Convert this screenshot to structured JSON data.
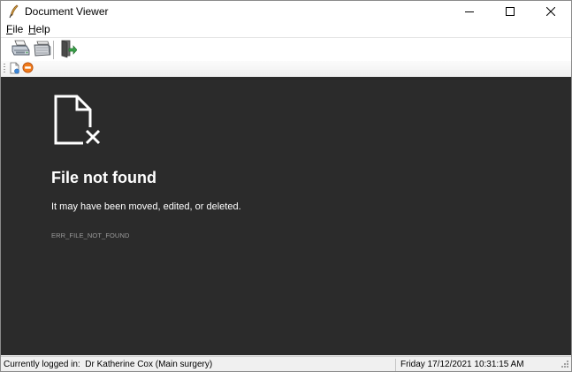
{
  "window": {
    "title": "Document Viewer"
  },
  "menu": {
    "file": {
      "mnemonic": "F",
      "rest": "ile"
    },
    "help": {
      "mnemonic": "H",
      "rest": "elp"
    }
  },
  "toolbar": {
    "icons": [
      "printer-icon",
      "scanner-icon",
      "exit-door-icon"
    ]
  },
  "small_toolbar": {
    "icons": [
      "new-document-icon",
      "stop-icon"
    ]
  },
  "content": {
    "error_title": "File not found",
    "error_message": "It may have been moved, edited, or deleted.",
    "error_code": "ERR_FILE_NOT_FOUND"
  },
  "status": {
    "logged_in_label": "Currently logged in:",
    "user": "Dr Katherine Cox (Main surgery)",
    "datetime": "Friday 17/12/2021 10:31:15 AM"
  },
  "colors": {
    "content_background": "#2b2b2b",
    "error_text": "#ffffff",
    "error_code_text": "#9a9a9a"
  }
}
